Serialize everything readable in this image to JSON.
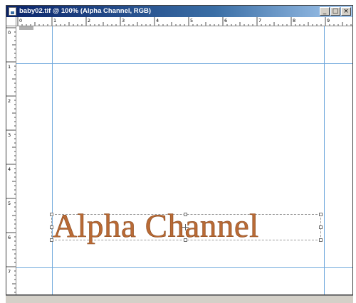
{
  "window": {
    "title": "baby02.tif @ 100% (Alpha Channel, RGB)",
    "buttons": {
      "minimize": "_",
      "maximize": "□",
      "close": "×"
    }
  },
  "rulers": {
    "horizontal_labels": [
      "0",
      "1",
      "2",
      "3",
      "4",
      "5",
      "6",
      "7",
      "8",
      "9"
    ],
    "vertical_labels": [
      "0",
      "1",
      "2",
      "3",
      "4",
      "5",
      "6",
      "7"
    ]
  },
  "canvas": {
    "text_layer": "Alpha Channel",
    "text_color": "#b96a35",
    "guide_color": "#6fa8dc"
  }
}
